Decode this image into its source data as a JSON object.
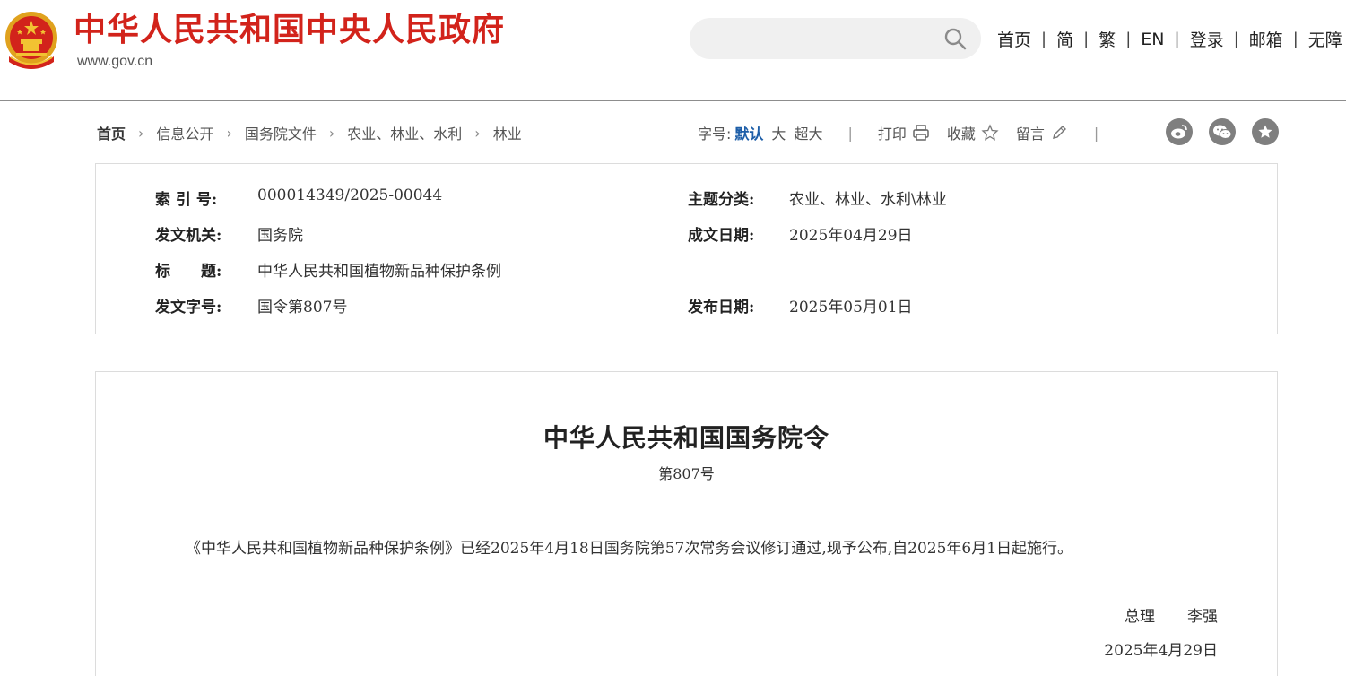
{
  "header": {
    "site_title": "中华人民共和国中央人民政府",
    "site_url": "www.gov.cn",
    "search_placeholder": "",
    "nav": [
      "首页",
      "简",
      "繁",
      "EN",
      "登录",
      "邮箱",
      "无障"
    ],
    "nav_separator": "|"
  },
  "breadcrumb": {
    "items": [
      "首页",
      "信息公开",
      "国务院文件",
      "农业、林业、水利",
      "林业"
    ]
  },
  "toolbar": {
    "font_size_label": "字号:",
    "font_default": "默认",
    "font_large": "大",
    "font_xlarge": "超大",
    "print": "打印",
    "favorite": "收藏",
    "comment": "留言"
  },
  "social": [
    "weibo-icon",
    "wechat-icon",
    "favorite-star-icon"
  ],
  "info": {
    "index_label": "索 引 号:",
    "index_value": "000014349/2025-00044",
    "topic_label": "主题分类:",
    "topic_value": "农业、林业、水利\\林业",
    "issuer_label": "发文机关:",
    "issuer_value": "国务院",
    "created_label": "成文日期:",
    "created_value": "2025年04月29日",
    "title_label": "标　　题:",
    "title_value": "中华人民共和国植物新品种保护条例",
    "docno_label": "发文字号:",
    "docno_value": "国令第807号",
    "published_label": "发布日期:",
    "published_value": "2025年05月01日"
  },
  "document": {
    "title": "中华人民共和国国务院令",
    "number": "第807号",
    "paragraph": "《中华人民共和国植物新品种保护条例》已经2025年4月18日国务院第57次常务会议修订通过,现予公布,自2025年6月1日起施行。",
    "signer_title": "总理",
    "signer_name": "李强",
    "sign_date": "2025年4月29日"
  },
  "colors": {
    "brand_red": "#d2231b",
    "active_blue": "#1d5ea8",
    "icon_gray": "#7f7f7f"
  }
}
